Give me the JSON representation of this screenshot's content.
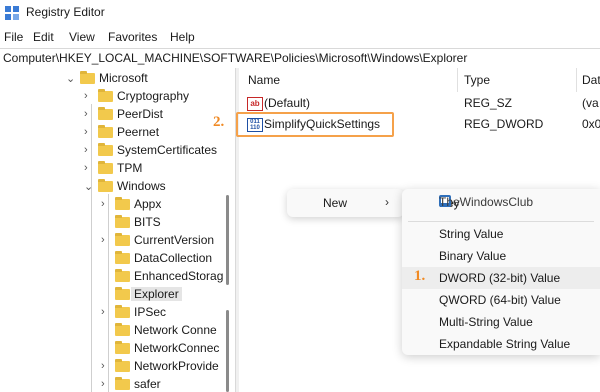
{
  "window": {
    "title": "Registry Editor"
  },
  "menu": [
    "File",
    "Edit",
    "View",
    "Favorites",
    "Help"
  ],
  "address": "Computer\\HKEY_LOCAL_MACHINE\\SOFTWARE\\Policies\\Microsoft\\Windows\\Explorer",
  "tree": {
    "items": [
      {
        "label": "Microsoft",
        "expanded": true
      },
      {
        "label": "Cryptography",
        "expanded": false
      },
      {
        "label": "PeerDist",
        "expanded": false
      },
      {
        "label": "Peernet",
        "expanded": false
      },
      {
        "label": "SystemCertificates",
        "expanded": false
      },
      {
        "label": "TPM",
        "expanded": false
      },
      {
        "label": "Windows",
        "expanded": true
      },
      {
        "label": "Appx",
        "expanded": false
      },
      {
        "label": "BITS",
        "expanded": false
      },
      {
        "label": "CurrentVersion",
        "expanded": false
      },
      {
        "label": "DataCollection",
        "expanded": false
      },
      {
        "label": "EnhancedStorag",
        "expanded": false
      },
      {
        "label": "Explorer",
        "expanded": false,
        "selected": true
      },
      {
        "label": "IPSec",
        "expanded": false
      },
      {
        "label": "Network Conne",
        "expanded": false
      },
      {
        "label": "NetworkConnec",
        "expanded": false
      },
      {
        "label": "NetworkProvide",
        "expanded": false
      },
      {
        "label": "safer",
        "expanded": false
      }
    ]
  },
  "list": {
    "headers": {
      "name": "Name",
      "type": "Type",
      "data": "Dat"
    },
    "rows": [
      {
        "icon": "string-value-icon",
        "icon_text": "ab",
        "name": "(Default)",
        "type": "REG_SZ",
        "data": "(va"
      },
      {
        "icon": "binary-value-icon",
        "icon_text": "011 110",
        "name": "SimplifyQuickSettings",
        "type": "REG_DWORD",
        "data": "0x0"
      }
    ]
  },
  "context_menu": {
    "new_label": "New",
    "arrow": "›"
  },
  "submenu": {
    "key_label": "Key",
    "items": [
      "String Value",
      "Binary Value",
      "DWORD (32-bit) Value",
      "QWORD (64-bit) Value",
      "Multi-String Value",
      "Expandable String Value"
    ]
  },
  "watermark": "TheWindowsClub",
  "steps": {
    "one": "1.",
    "two": "2."
  },
  "colors": {
    "accent": "#f08a24",
    "folder": "#f2c94c"
  }
}
